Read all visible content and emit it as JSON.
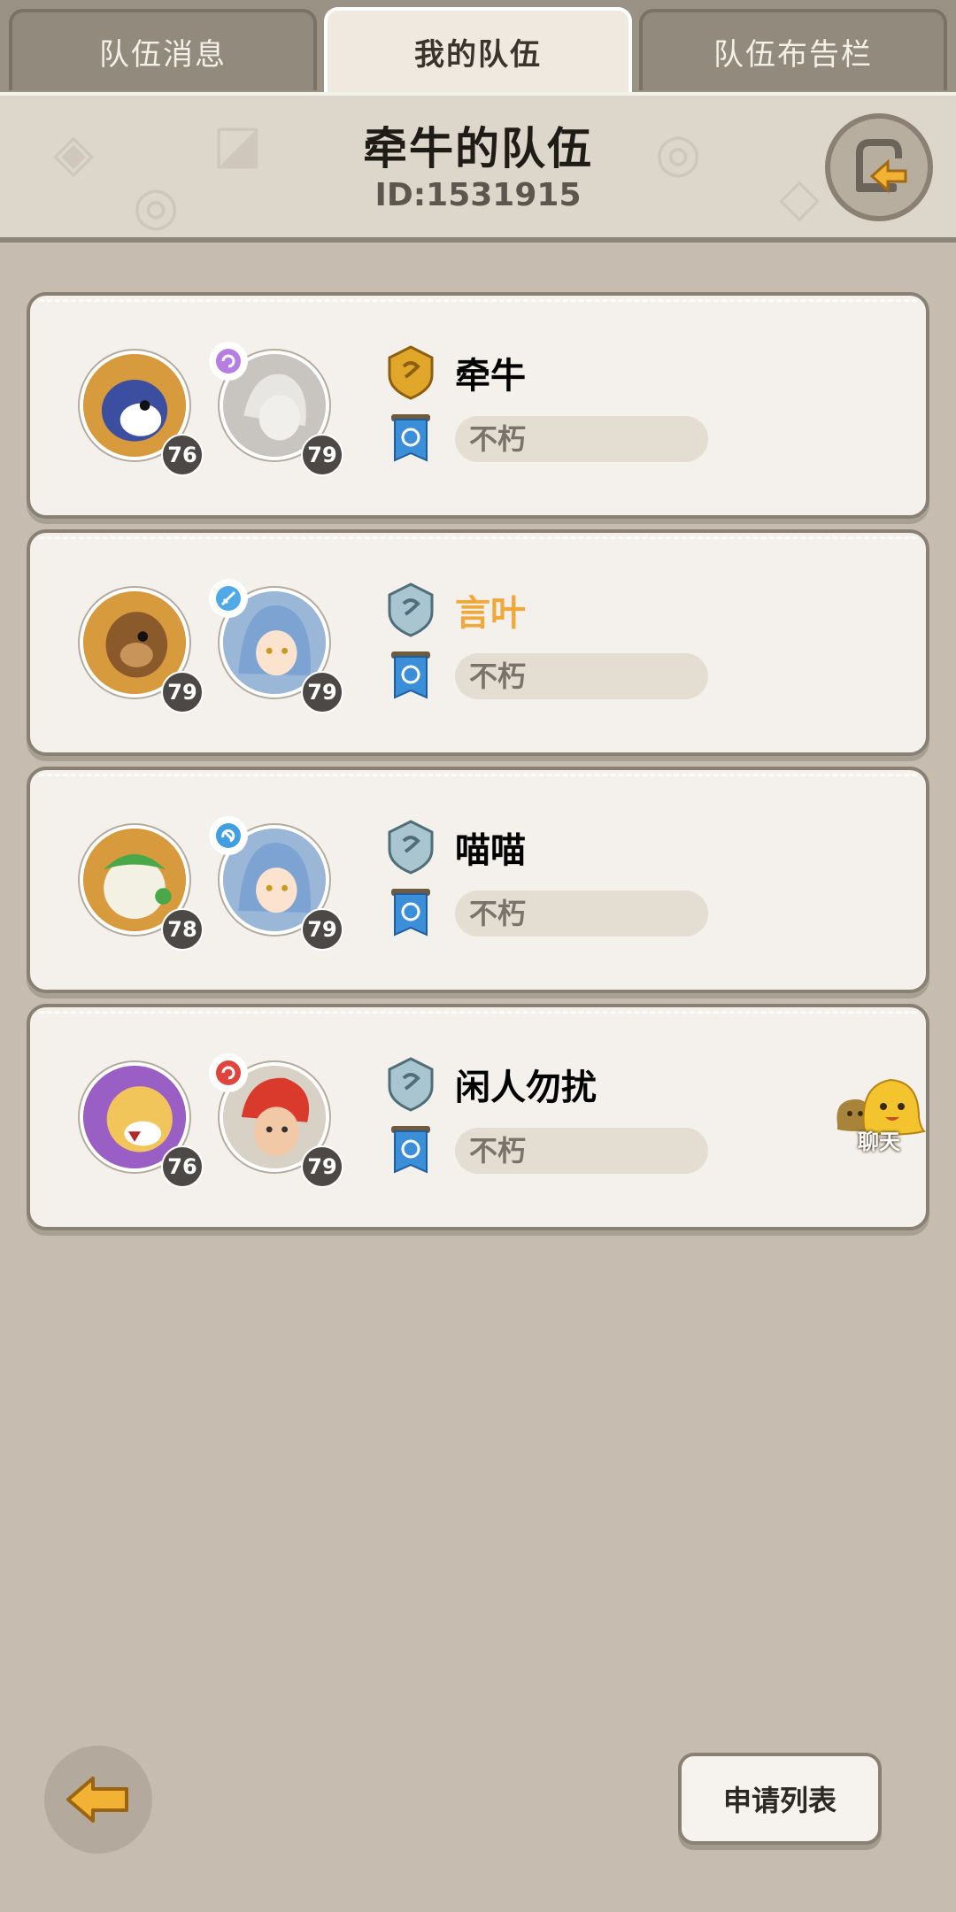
{
  "tabs": [
    {
      "label": "队伍消息",
      "active": false
    },
    {
      "label": "我的队伍",
      "active": true
    },
    {
      "label": "队伍布告栏",
      "active": false
    }
  ],
  "header": {
    "title": "牵牛的队伍",
    "id_text": "ID:1531915",
    "exit_icon": "exit-team-icon"
  },
  "members": [
    {
      "name": "牵牛",
      "name_color": "#1f1c18",
      "rank": "gold",
      "pet_level": "76",
      "char_level": "79",
      "guild": "不朽",
      "element": "purple-swirl"
    },
    {
      "name": "言叶",
      "name_color": "#f0a83a",
      "rank": "silver",
      "pet_level": "79",
      "char_level": "79",
      "guild": "不朽",
      "element": "blue-sword"
    },
    {
      "name": "喵喵",
      "name_color": "#1f1c18",
      "rank": "silver",
      "pet_level": "78",
      "char_level": "79",
      "guild": "不朽",
      "element": "blue-swirl"
    },
    {
      "name": "闲人勿扰",
      "name_color": "#1f1c18",
      "rank": "silver",
      "pet_level": "76",
      "char_level": "79",
      "guild": "不朽",
      "element": "red-swirl"
    }
  ],
  "chat": {
    "label": "聊天"
  },
  "footer": {
    "apply_label": "申请列表",
    "back_icon": "back-arrow-icon"
  },
  "colors": {
    "background": "#c6bdb0",
    "card": "#f4f1ec",
    "highlight_name": "#f0a83a"
  }
}
